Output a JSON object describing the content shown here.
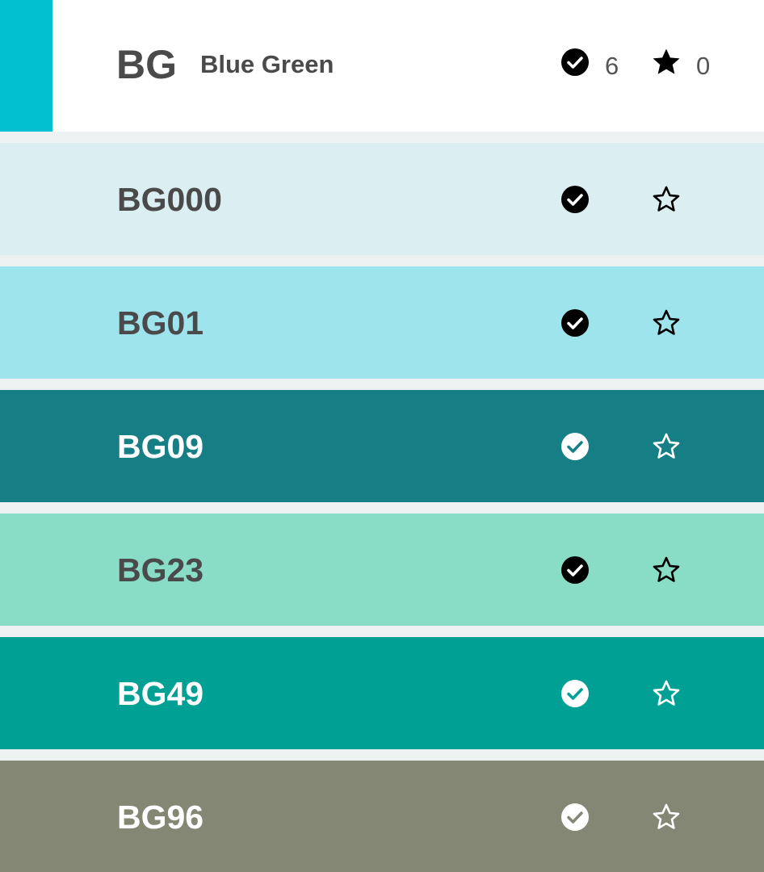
{
  "header": {
    "code": "BG",
    "name": "Blue Green",
    "accent_color": "#03c0d0",
    "checked_icon": "check-circle-icon",
    "checked_count": "6",
    "favorite_icon": "star-filled-icon",
    "favorite_count": "0"
  },
  "colors": [
    {
      "code": "BG000",
      "bg": "#dbeef2",
      "text": "#4a4a4a",
      "owned": true,
      "favorite": false,
      "icon_color": "#000000",
      "check_mark_color": "#ffffff"
    },
    {
      "code": "BG01",
      "bg": "#9ee4ec",
      "text": "#4a4a4a",
      "owned": true,
      "favorite": false,
      "icon_color": "#000000",
      "check_mark_color": "#ffffff"
    },
    {
      "code": "BG09",
      "bg": "#167f85",
      "text": "#ffffff",
      "owned": true,
      "favorite": false,
      "icon_color": "#ffffff",
      "check_mark_color": "#167f85"
    },
    {
      "code": "BG23",
      "bg": "#89ddc6",
      "text": "#4a4a4a",
      "owned": true,
      "favorite": false,
      "icon_color": "#000000",
      "check_mark_color": "#ffffff"
    },
    {
      "code": "BG49",
      "bg": "#00a194",
      "text": "#ffffff",
      "owned": true,
      "favorite": false,
      "icon_color": "#ffffff",
      "check_mark_color": "#00a194"
    },
    {
      "code": "BG96",
      "bg": "#838773",
      "text": "#ffffff",
      "owned": true,
      "favorite": false,
      "icon_color": "#ffffff",
      "check_mark_color": "#838773"
    }
  ]
}
